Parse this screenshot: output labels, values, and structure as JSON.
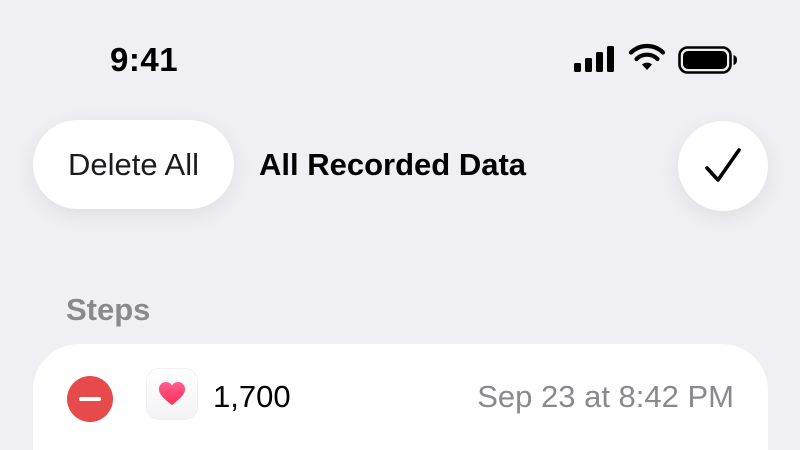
{
  "status_bar": {
    "time": "9:41",
    "icons": [
      "cellular-signal-icon",
      "wifi-icon",
      "battery-icon"
    ]
  },
  "nav": {
    "delete_all_label": "Delete All",
    "title": "All Recorded Data",
    "done_icon": "checkmark-icon"
  },
  "section": {
    "header": "Steps"
  },
  "records": [
    {
      "value": "1,700",
      "date": "Sep 23 at 8:42 PM",
      "source_icon": "health-heart-icon"
    }
  ],
  "colors": {
    "background": "#efeff4",
    "delete_red": "#e64a4a",
    "secondary_text": "#8a8a8e",
    "heart_pink": "#ff3b6b"
  }
}
